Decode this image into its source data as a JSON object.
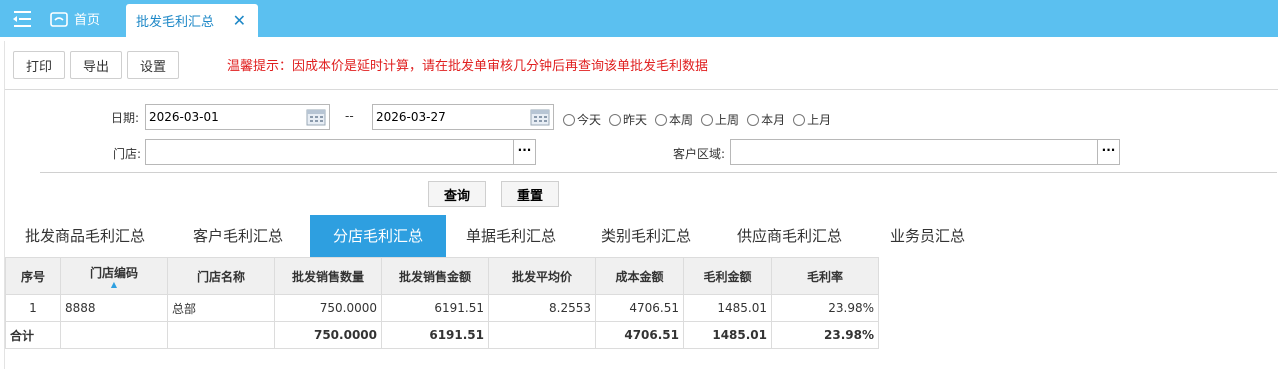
{
  "header": {
    "home_label": "首页",
    "active_tab_label": "批发毛利汇总",
    "close_glyph": "✕"
  },
  "toolbar": {
    "print_label": "打印",
    "export_label": "导出",
    "settings_label": "设置",
    "notice": "温馨提示：因成本价是延时计算，请在批发单审核几分钟后再查询该单批发毛利数据"
  },
  "filters": {
    "date_label": "日期:",
    "date_from": "2026-03-01",
    "date_sep": "--",
    "date_to": "2026-03-27",
    "quick_ranges": [
      "今天",
      "昨天",
      "本周",
      "上周",
      "本月",
      "上月"
    ],
    "store_label": "门店:",
    "store_value": "",
    "region_label": "客户区域:",
    "region_value": "",
    "dots": "···",
    "query_label": "查询",
    "reset_label": "重置"
  },
  "report_tabs": [
    "批发商品毛利汇总",
    "客户毛利汇总",
    "分店毛利汇总",
    "单据毛利汇总",
    "类别毛利汇总",
    "供应商毛利汇总",
    "业务员汇总"
  ],
  "selected_report_tab": 2,
  "table": {
    "headers": [
      "序号",
      "门店编码",
      "门店名称",
      "批发销售数量",
      "批发销售金额",
      "批发平均价",
      "成本金额",
      "毛利金额",
      "毛利率"
    ],
    "sort_indicator": "▲",
    "rows": [
      [
        "1",
        "8888",
        "总部",
        "750.0000",
        "6191.51",
        "8.2553",
        "4706.51",
        "1485.01",
        "23.98%"
      ]
    ],
    "total_row": [
      "合计",
      "",
      "",
      "750.0000",
      "6191.51",
      "",
      "4706.51",
      "1485.01",
      "23.98%"
    ]
  },
  "colors": {
    "topbar": "#5bc0f0",
    "selected_tab": "#2e9fe0",
    "notice": "#e02020"
  }
}
